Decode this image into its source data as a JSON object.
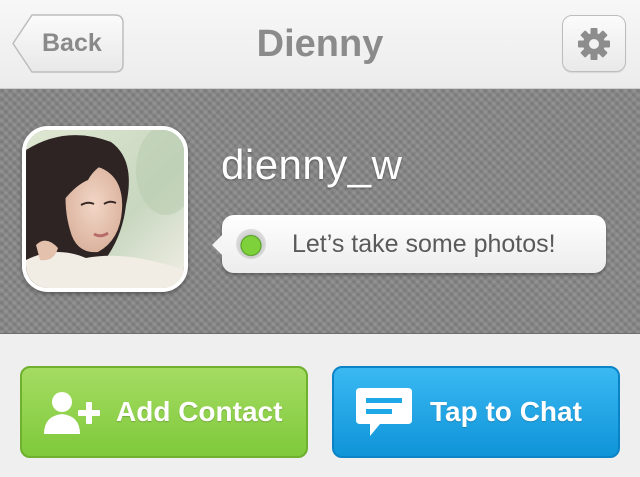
{
  "navbar": {
    "back_label": "Back",
    "title": "Dienny",
    "settings_icon": "gear-icon"
  },
  "profile": {
    "username": "dienny_w",
    "status_message": "Let’s take some photos!",
    "status_color": "#6cc22c",
    "avatar_icon": "profile-photo"
  },
  "actions": {
    "add_contact_label": "Add Contact",
    "add_contact_icon": "add-user-icon",
    "add_contact_color": "#8ed04b",
    "tap_to_chat_label": "Tap to Chat",
    "tap_to_chat_icon": "chat-bubble-icon",
    "tap_to_chat_color": "#1ea8e8"
  }
}
